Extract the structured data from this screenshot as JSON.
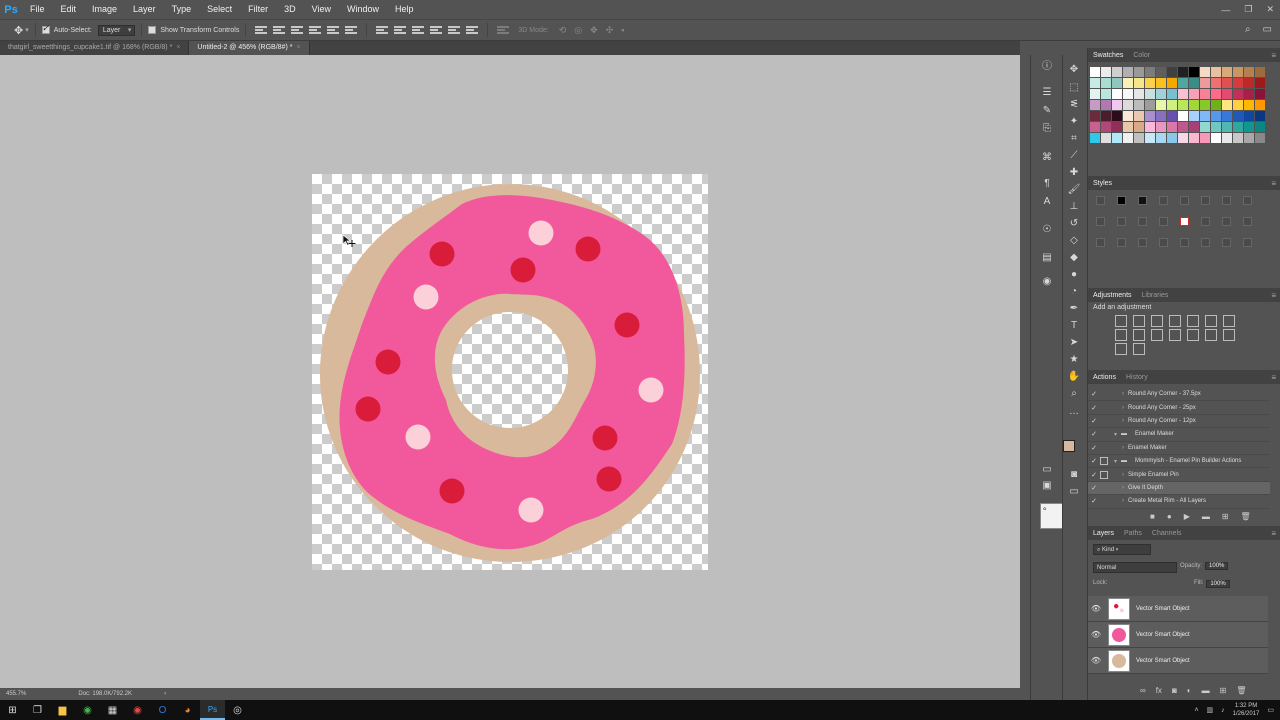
{
  "app": {
    "logo": "Ps"
  },
  "menu": [
    "File",
    "Edit",
    "Image",
    "Layer",
    "Type",
    "Select",
    "Filter",
    "3D",
    "View",
    "Window",
    "Help"
  ],
  "window_controls": [
    "—",
    "❐",
    "✕"
  ],
  "options": {
    "auto_select_label": "Auto-Select:",
    "auto_select_value": "Layer",
    "transform_label": "Show Transform Controls",
    "mode_3d_label": "3D Mode:"
  },
  "doc_tabs": [
    {
      "title": "thatgirl_sweetthings_cupcake1.tif @ 168% (RGB/8) *",
      "active": false
    },
    {
      "title": "Untitled-2 @ 456% (RGB/8#) *",
      "active": true
    }
  ],
  "status": {
    "zoom": "455.7%",
    "doc": "Doc: 198.0K/792.2K"
  },
  "panels": {
    "swatches_tab": "Swatches",
    "color_tab": "Color",
    "styles_tab": "Styles",
    "adjustments_tab": "Adjustments",
    "libraries_tab": "Libraries",
    "add_adjustment": "Add an adjustment",
    "actions_tab": "Actions",
    "history_tab": "History",
    "layers_tab": "Layers",
    "paths_tab": "Paths",
    "channels_tab": "Channels"
  },
  "actions": [
    {
      "label": "Round Any Corner - 37.5px",
      "indent": 1,
      "folder": false,
      "selected": false,
      "dialog": false
    },
    {
      "label": "Round Any Corner - 25px",
      "indent": 1,
      "folder": false,
      "selected": false,
      "dialog": false
    },
    {
      "label": "Round Any Corner - 12px",
      "indent": 1,
      "folder": false,
      "selected": false,
      "dialog": false
    },
    {
      "label": "Enamel Maker",
      "indent": 0,
      "folder": true,
      "selected": false,
      "dialog": false
    },
    {
      "label": "Enamel Maker",
      "indent": 1,
      "folder": false,
      "selected": false,
      "dialog": false
    },
    {
      "label": "Mommyish - Enamel Pin Builder Actions",
      "indent": 0,
      "folder": true,
      "selected": false,
      "dialog": true
    },
    {
      "label": "Simple Enamel Pin",
      "indent": 1,
      "folder": false,
      "selected": false,
      "dialog": true
    },
    {
      "label": "Give It Depth",
      "indent": 1,
      "folder": false,
      "selected": true,
      "dialog": false
    },
    {
      "label": "Create Metal Rim - All Layers",
      "indent": 1,
      "folder": false,
      "selected": false,
      "dialog": false
    }
  ],
  "layers": {
    "kind_label": "Kind",
    "blend_mode": "Normal",
    "opacity_label": "Opacity:",
    "opacity_value": "100%",
    "lock_label": "Lock:",
    "fill_label": "Fill:",
    "fill_value": "100%",
    "items": [
      {
        "name": "Vector Smart Object",
        "thumb": "sprinkles"
      },
      {
        "name": "Vector Smart Object",
        "thumb": "icing"
      },
      {
        "name": "Vector Smart Object",
        "thumb": "dough"
      }
    ]
  },
  "colors": {
    "dough": "#d9b99b",
    "icing": "#f2589c",
    "sprinkle_red": "#d91c3a",
    "sprinkle_pink": "#fbd0d8",
    "foreground": "#d8b89c",
    "background": "#ffffff"
  },
  "taskbar": {
    "time": "1:32 PM",
    "date": "1/26/2017"
  }
}
